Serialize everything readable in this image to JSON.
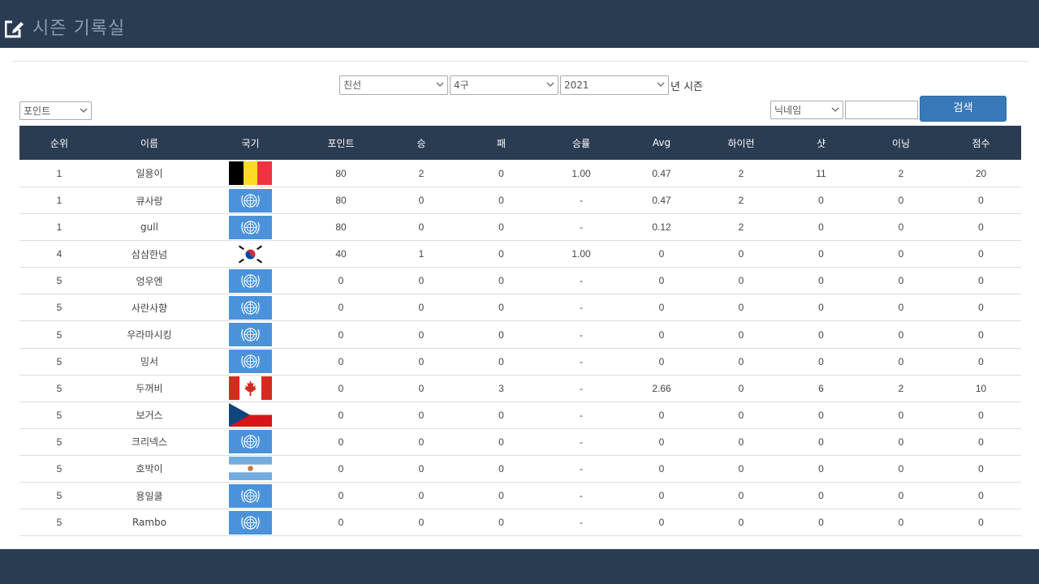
{
  "app": {
    "title": "시즌 기록실",
    "icon": "edit-icon"
  },
  "filters": {
    "division": "친선",
    "zone": "4구",
    "year": "2021",
    "year_suffix": "년 시즌",
    "sort": "포인트",
    "search_field": "닉네임",
    "search_value": "",
    "search_label": "검색"
  },
  "table": {
    "columns": [
      "순위",
      "이름",
      "국기",
      "포인트",
      "승",
      "패",
      "승률",
      "Avg",
      "하이런",
      "샷",
      "이닝",
      "점수"
    ],
    "rows": [
      {
        "rank": "1",
        "name": "일용이",
        "flag": "belgium",
        "points": "80",
        "wins": "2",
        "losses": "0",
        "win_rate": "1.00",
        "avg": "0.47",
        "high_run": "2",
        "shots": "11",
        "innings": "2",
        "score": "20"
      },
      {
        "rank": "1",
        "name": "큐사랑",
        "flag": "un",
        "points": "80",
        "wins": "0",
        "losses": "0",
        "win_rate": "-",
        "avg": "0.47",
        "high_run": "2",
        "shots": "0",
        "innings": "0",
        "score": "0"
      },
      {
        "rank": "1",
        "name": "gull",
        "flag": "un",
        "points": "80",
        "wins": "0",
        "losses": "0",
        "win_rate": "-",
        "avg": "0.12",
        "high_run": "2",
        "shots": "0",
        "innings": "0",
        "score": "0"
      },
      {
        "rank": "4",
        "name": "삼삼한넘",
        "flag": "korea",
        "points": "40",
        "wins": "1",
        "losses": "0",
        "win_rate": "1.00",
        "avg": "0",
        "high_run": "0",
        "shots": "0",
        "innings": "0",
        "score": "0"
      },
      {
        "rank": "5",
        "name": "엉우엔",
        "flag": "un",
        "points": "0",
        "wins": "0",
        "losses": "0",
        "win_rate": "-",
        "avg": "0",
        "high_run": "0",
        "shots": "0",
        "innings": "0",
        "score": "0"
      },
      {
        "rank": "5",
        "name": "사란사향",
        "flag": "un",
        "points": "0",
        "wins": "0",
        "losses": "0",
        "win_rate": "-",
        "avg": "0",
        "high_run": "0",
        "shots": "0",
        "innings": "0",
        "score": "0"
      },
      {
        "rank": "5",
        "name": "우라마시킹",
        "flag": "un",
        "points": "0",
        "wins": "0",
        "losses": "0",
        "win_rate": "-",
        "avg": "0",
        "high_run": "0",
        "shots": "0",
        "innings": "0",
        "score": "0"
      },
      {
        "rank": "5",
        "name": "밍서",
        "flag": "un",
        "points": "0",
        "wins": "0",
        "losses": "0",
        "win_rate": "-",
        "avg": "0",
        "high_run": "0",
        "shots": "0",
        "innings": "0",
        "score": "0"
      },
      {
        "rank": "5",
        "name": "두꺼비",
        "flag": "canada",
        "points": "0",
        "wins": "0",
        "losses": "3",
        "win_rate": "-",
        "avg": "2.66",
        "high_run": "0",
        "shots": "6",
        "innings": "2",
        "score": "10"
      },
      {
        "rank": "5",
        "name": "보거스",
        "flag": "czech",
        "points": "0",
        "wins": "0",
        "losses": "0",
        "win_rate": "-",
        "avg": "0",
        "high_run": "0",
        "shots": "0",
        "innings": "0",
        "score": "0"
      },
      {
        "rank": "5",
        "name": "크리넥스",
        "flag": "un",
        "points": "0",
        "wins": "0",
        "losses": "0",
        "win_rate": "-",
        "avg": "0",
        "high_run": "0",
        "shots": "0",
        "innings": "0",
        "score": "0"
      },
      {
        "rank": "5",
        "name": "호박이",
        "flag": "argentina",
        "points": "0",
        "wins": "0",
        "losses": "0",
        "win_rate": "-",
        "avg": "0",
        "high_run": "0",
        "shots": "0",
        "innings": "0",
        "score": "0"
      },
      {
        "rank": "5",
        "name": "용일쿨",
        "flag": "un",
        "points": "0",
        "wins": "0",
        "losses": "0",
        "win_rate": "-",
        "avg": "0",
        "high_run": "0",
        "shots": "0",
        "innings": "0",
        "score": "0"
      },
      {
        "rank": "5",
        "name": "Rambo",
        "flag": "un",
        "points": "0",
        "wins": "0",
        "losses": "0",
        "win_rate": "-",
        "avg": "0",
        "high_run": "0",
        "shots": "0",
        "innings": "0",
        "score": "0"
      }
    ]
  },
  "colors": {
    "header_bg": "#2a3c52",
    "button": "#3a79b8"
  }
}
